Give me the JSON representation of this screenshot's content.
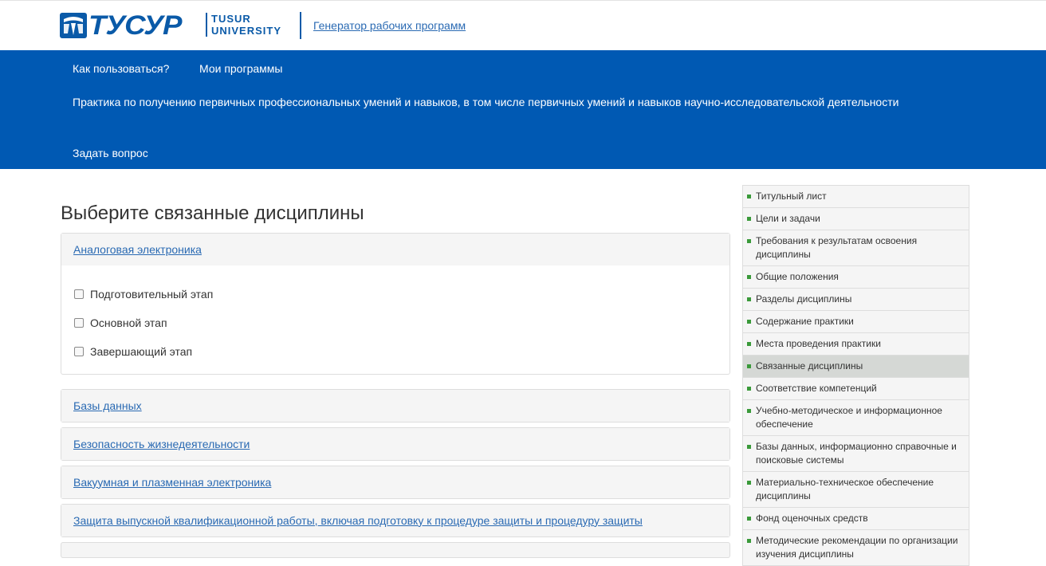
{
  "header": {
    "logo_text": "ТУСУР",
    "logo_sub_line1": "TUSUR",
    "logo_sub_line2": "UNIVERSITY",
    "generator_link": "Генератор рабочих программ",
    "brand_color": "#0059b3"
  },
  "nav": {
    "how_to": "Как пользоваться?",
    "my_programs": "Мои программы",
    "practice": "Практика по получению первичных профессиональных умений и навыков, в том числе первичных умений и навыков научно-исследовательской деятельности",
    "ask": "Задать вопрос"
  },
  "main": {
    "title": "Выберите связанные дисциплины",
    "expanded": {
      "name": "Аналоговая электроника",
      "stages": [
        "Подготовительный этап",
        "Основной этап",
        "Завершающий этап"
      ]
    },
    "disciplines": [
      "Базы данных",
      "Безопасность жизнедеятельности",
      "Вакуумная и плазменная электроника",
      "Защита выпускной квалификационной работы, включая подготовку к процедуре защиты и процедуру защиты"
    ]
  },
  "sidebar": {
    "items": [
      "Титульный лист",
      "Цели и задачи",
      "Требования к результатам освоения дисциплины",
      "Общие положения",
      "Разделы дисциплины",
      "Содержание практики",
      "Места проведения практики",
      "Связанные дисциплины",
      "Соответствие компетенций",
      "Учебно-методическое и информационное обеспечение",
      "Базы данных, информационно справочные и поисковые системы",
      "Материально-техническое обеспечение дисциплины",
      "Фонд оценочных средств",
      "Методические рекомендации по организации изучения дисциплины"
    ],
    "active_index": 7,
    "bullet_color": "#3a9a3a"
  }
}
